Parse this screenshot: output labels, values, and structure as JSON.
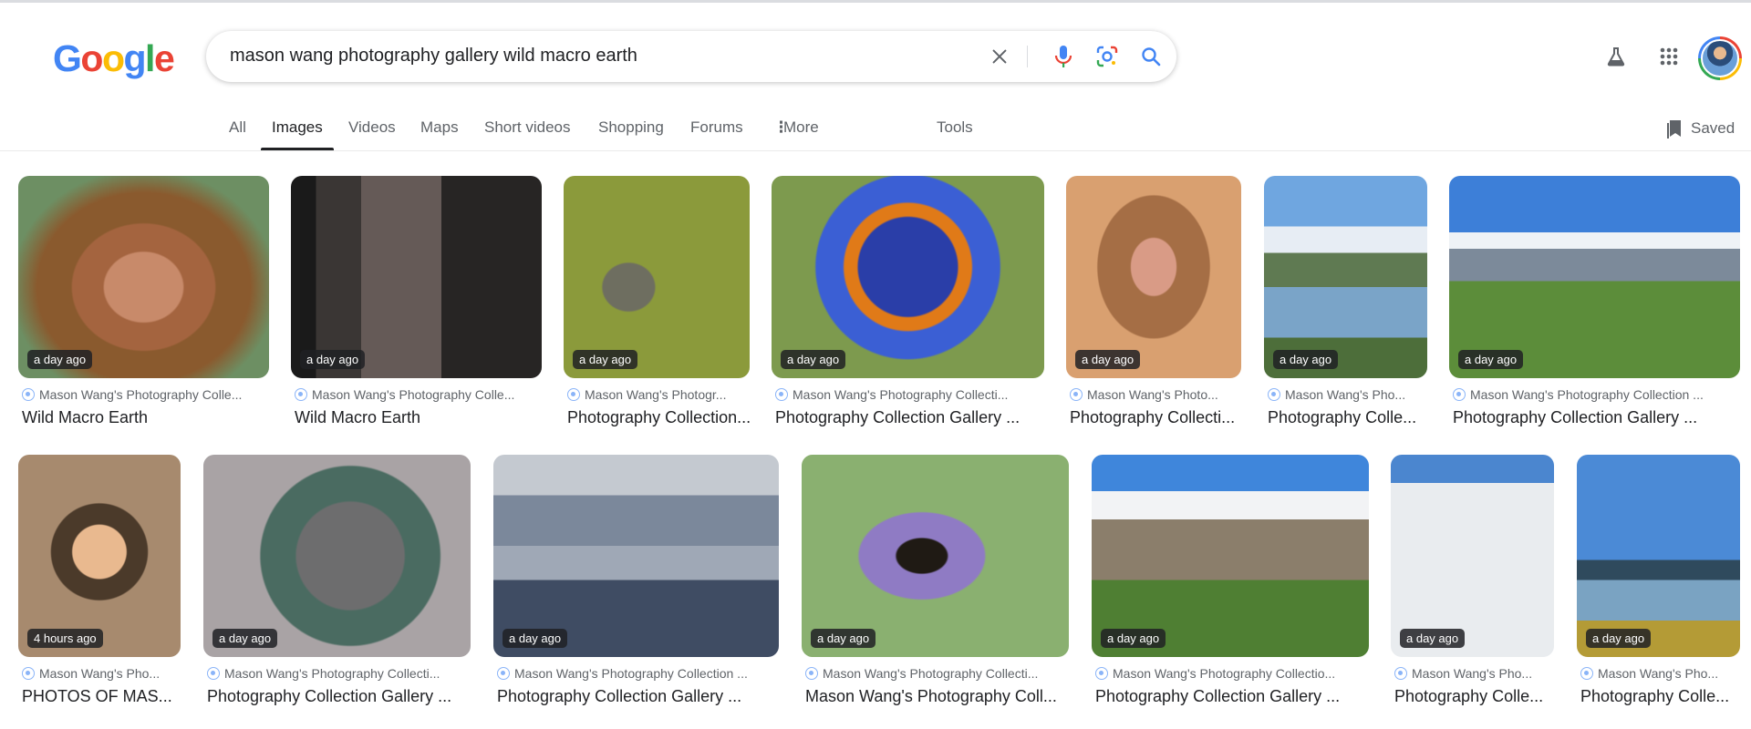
{
  "search": {
    "query": "mason wang photography gallery wild macro earth"
  },
  "logo": {
    "letters": [
      "G",
      "o",
      "o",
      "g",
      "l",
      "e"
    ]
  },
  "tabs": [
    {
      "label": "All",
      "active": false
    },
    {
      "label": "Images",
      "active": true
    },
    {
      "label": "Videos",
      "active": false
    },
    {
      "label": "Maps",
      "active": false
    },
    {
      "label": "Short videos",
      "active": false
    },
    {
      "label": "Shopping",
      "active": false
    },
    {
      "label": "Forums",
      "active": false
    },
    {
      "label": "More",
      "active": false
    },
    {
      "label": "Tools",
      "active": false
    }
  ],
  "saved_label": "Saved",
  "results": [
    {
      "badge": "a day ago",
      "source": "Mason Wang's Photography Colle...",
      "title": "Wild Macro Earth",
      "picture": "rhesus-macaque-portrait"
    },
    {
      "badge": "a day ago",
      "source": "Mason Wang's Photography Colle...",
      "title": "Wild Macro Earth",
      "picture": "hippo-open-mouth"
    },
    {
      "badge": "a day ago",
      "source": "Mason Wang's Photogr...",
      "title": "Photography Collection...",
      "picture": "hummingbird-flower"
    },
    {
      "badge": "a day ago",
      "source": "Mason Wang's Photography Collecti...",
      "title": "Photography Collection Gallery ...",
      "picture": "lorikeet-parrot"
    },
    {
      "badge": "a day ago",
      "source": "Mason Wang's Photo...",
      "title": "Photography Collecti...",
      "picture": "monkey-sitting"
    },
    {
      "badge": "a day ago",
      "source": "Mason Wang's Pho...",
      "title": "Photography Colle...",
      "picture": "alpine-lake-reflection"
    },
    {
      "badge": "a day ago",
      "source": "Mason Wang's Photography Collection ...",
      "title": "Photography Collection Gallery ...",
      "picture": "alpine-valley"
    },
    {
      "badge": "4 hours ago",
      "source": "Mason Wang's Pho...",
      "title": "PHOTOS OF MAS...",
      "picture": "boy-with-hat"
    },
    {
      "badge": "a day ago",
      "source": "Mason Wang's Photography Collecti...",
      "title": "Photography Collection Gallery ...",
      "picture": "pigeon-closeup"
    },
    {
      "badge": "a day ago",
      "source": "Mason Wang's Photography Collection ...",
      "title": "Photography Collection Gallery ...",
      "picture": "misty-mountains"
    },
    {
      "badge": "a day ago",
      "source": "Mason Wang's Photography Collecti...",
      "title": "Mason Wang's Photography Coll...",
      "picture": "bee-on-lavender"
    },
    {
      "badge": "a day ago",
      "source": "Mason Wang's Photography Collectio...",
      "title": "Photography Collection Gallery ...",
      "picture": "mountain-clouds"
    },
    {
      "badge": "a day ago",
      "source": "Mason Wang's Pho...",
      "title": "Photography Colle...",
      "picture": "glacier"
    },
    {
      "badge": "a day ago",
      "source": "Mason Wang's Pho...",
      "title": "Photography Colle...",
      "picture": "harbor-lake"
    }
  ],
  "colors": {
    "link_blue": "#4285f4",
    "mic_red": "#ea4335",
    "text_secondary": "#5f6368"
  }
}
